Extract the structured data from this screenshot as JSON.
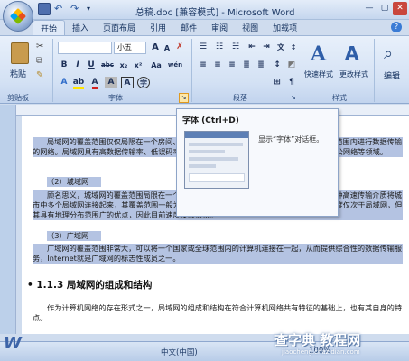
{
  "window": {
    "title": "总稿.doc [兼容模式] - Microsoft Word",
    "controls": [
      "—",
      "▢",
      "✕"
    ]
  },
  "tabs": [
    "开始",
    "插入",
    "页面布局",
    "引用",
    "邮件",
    "审阅",
    "视图",
    "加载项"
  ],
  "ribbon": {
    "clipboard": {
      "paste_label": "粘贴",
      "group_label": "剪贴板"
    },
    "font": {
      "font_size": "小五",
      "group_label": "字体",
      "bold": "B",
      "italic": "I",
      "underline": "U",
      "strike": "abc",
      "subscript": "x₂",
      "superscript": "x²",
      "clear": "Aa",
      "grow": "A",
      "shrink": "A",
      "phonetic": "wén",
      "char_border": "A"
    },
    "paragraph": {
      "group_label": "段落"
    },
    "styles": {
      "quick_label": "快速样式",
      "change_label": "更改样式",
      "group_label": "样式"
    },
    "editing": {
      "label": "编辑"
    }
  },
  "tooltip": {
    "title": "字体 (Ctrl+D)",
    "description": "显示“字体”对话框。"
  },
  "document": {
    "paragraphs": [
      "局域网的覆盖范围仅仅局限在一个房间、一座建筑物或者一个单位内，它是在一个有限的范围内进行数据传输的网络。局域网具有高数据传输率、低误码率的特点，是目前应用最广泛的一类网络，单位办公网络等领域。",
      "（2）城域网",
      "顾名思义，城域网的覆盖范围局限在一个城市内，城域网是介于广域网与局域网之间的一种高速传输介质将城市中多个局域网连接起来，其覆盖范围一般为几十公里到几百公里，局域网与城域网的传输速度仅次于局域网，但其具有地理分布范围广的优点，因此目前速度发展很快。",
      "（3）广域网",
      "广域网的覆盖范围非常大，可以将一个国家或全球范围内的计算机连接在一起，从而提供综合性的数据传输服务，Internet就是广域网的标志性成员之一。"
    ],
    "heading": "1.1.3  局域网的组成和结构",
    "body": "作为计算机网络的存在形式之一，局域网的组成和结构在符合计算机网络共有特征的基础上，也有其自身的特点。"
  },
  "status": {
    "language": "中文(中国)",
    "zoom": "100%"
  },
  "watermark": {
    "text": "查字典 教程网",
    "url": "jiaocheng.chazidian.com"
  },
  "colors": {
    "selection": "#b4c3e2",
    "ribbon": "#d3e1f4",
    "accent": "#1e3a66"
  }
}
